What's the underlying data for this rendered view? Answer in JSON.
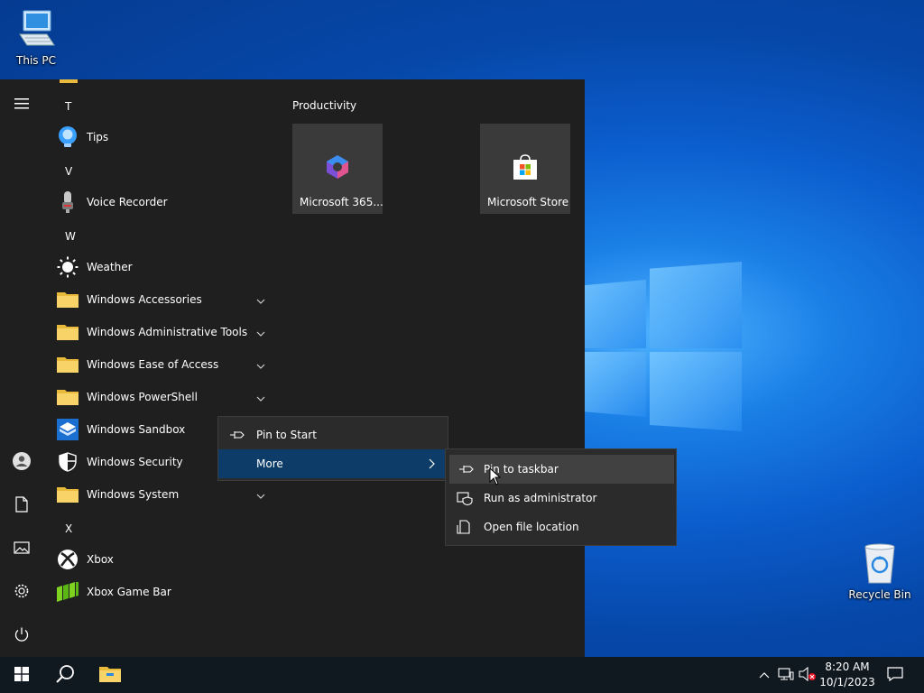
{
  "desktop": {
    "icons": [
      {
        "label": "This PC"
      },
      {
        "label": "Recycle Bin"
      }
    ]
  },
  "start_menu": {
    "rail": {
      "menu": "hamburger-icon",
      "user": "user-icon",
      "documents": "document-icon",
      "pictures": "pictures-icon",
      "settings": "gear-icon",
      "power": "power-icon"
    },
    "letters": [
      "T",
      "V",
      "W",
      "X"
    ],
    "apps": [
      {
        "label": "Tips",
        "icon": "tips-icon"
      },
      {
        "label": "Voice Recorder",
        "icon": "microphone-icon"
      },
      {
        "label": "Weather",
        "icon": "weather-icon"
      },
      {
        "label": "Windows Accessories",
        "icon": "folder-icon",
        "expandable": true
      },
      {
        "label": "Windows Administrative Tools",
        "icon": "folder-icon",
        "expandable": true
      },
      {
        "label": "Windows Ease of Access",
        "icon": "folder-icon",
        "expandable": true
      },
      {
        "label": "Windows PowerShell",
        "icon": "folder-icon",
        "expandable": true
      },
      {
        "label": "Windows Sandbox",
        "icon": "sandbox-icon"
      },
      {
        "label": "Windows Security",
        "icon": "shield-icon"
      },
      {
        "label": "Windows System",
        "icon": "folder-icon",
        "expandable": true
      },
      {
        "label": "Xbox",
        "icon": "xbox-icon"
      },
      {
        "label": "Xbox Game Bar",
        "icon": "game-bar-icon"
      }
    ],
    "tiles_group": "Productivity",
    "tiles": [
      {
        "label": "Microsoft 365..."
      },
      {
        "label": "Microsoft Store"
      }
    ]
  },
  "context_menu": {
    "items": [
      {
        "label": "Pin to Start",
        "icon": "pin-icon"
      },
      {
        "label": "More",
        "icon": "chevron-right-icon"
      }
    ],
    "submenu": [
      {
        "label": "Pin to taskbar",
        "icon": "pin-icon"
      },
      {
        "label": "Run as administrator",
        "icon": "admin-shield-icon"
      },
      {
        "label": "Open file location",
        "icon": "file-location-icon"
      }
    ]
  },
  "taskbar": {
    "clock_time": "8:20 AM",
    "clock_date": "10/1/2023"
  },
  "colors": {
    "start_bg": "#1f1f1f",
    "taskbar_bg": "#101820",
    "highlight": "#0c3c67",
    "submenu_hover": "#414141",
    "tile_bg": "#3a3a3a"
  }
}
